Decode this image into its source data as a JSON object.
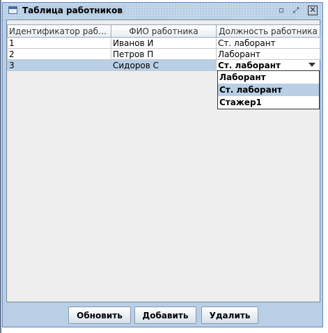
{
  "window": {
    "title": "Таблица работников"
  },
  "table": {
    "columns": [
      "Идентификатор работн...",
      "ФИО работника",
      "Должность работника"
    ],
    "rows": [
      [
        "1",
        "Иванов И",
        "Ст. лаборант"
      ],
      [
        "2",
        "Петров П",
        "Лаборант"
      ],
      [
        "3",
        "Сидоров С",
        "Ст. лаборант"
      ]
    ],
    "selected_row": 3
  },
  "dropdown": {
    "options": [
      "Лаборант",
      "Ст. лаборант",
      "Стажер1"
    ],
    "selected": "Ст. лаборант"
  },
  "buttons": {
    "refresh": "Обновить",
    "add": "Добавить",
    "delete": "Удалить"
  },
  "colors": {
    "title_bar": "#b8cfe5",
    "selection": "#b8cfe5",
    "border": "#6382bf"
  }
}
